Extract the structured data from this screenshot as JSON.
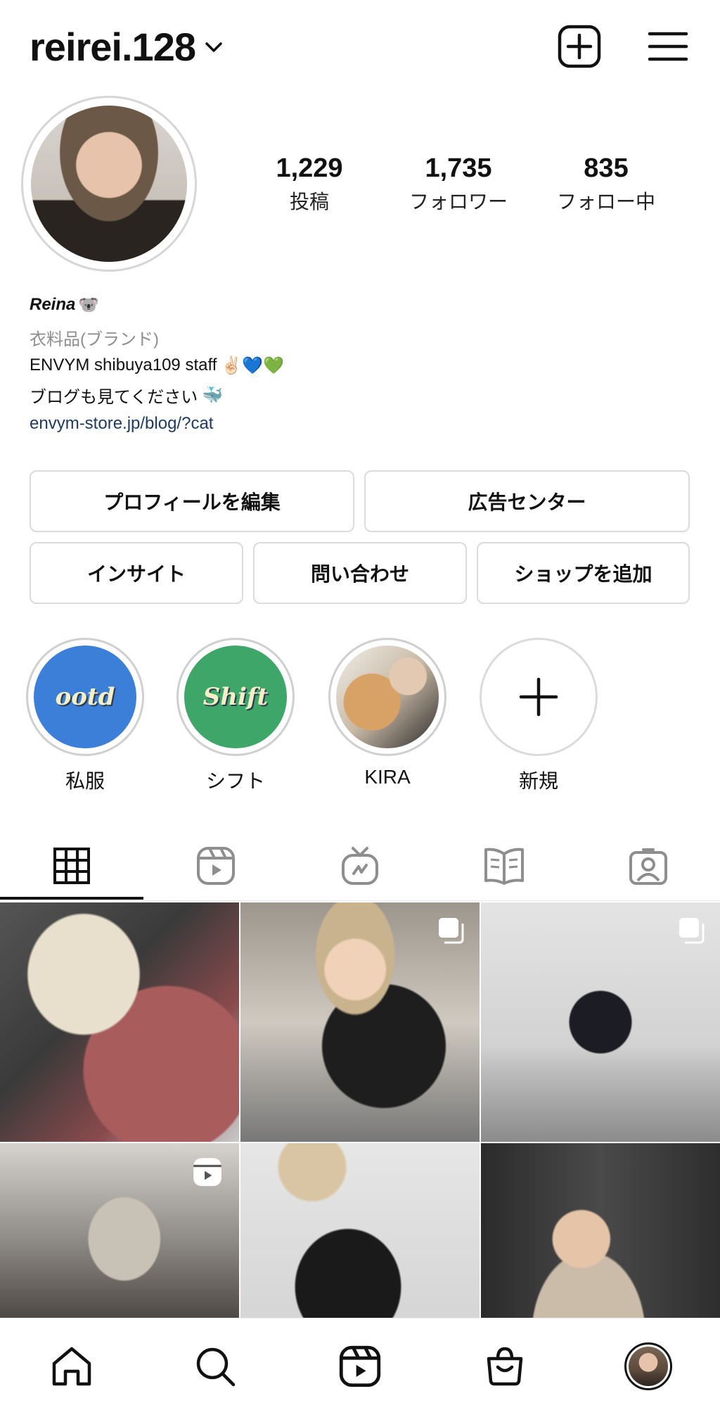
{
  "header": {
    "username": "reirei.128",
    "icons": [
      "chevron-down-icon",
      "plus-square-icon",
      "hamburger-menu-icon"
    ]
  },
  "stats": [
    {
      "value": "1,229",
      "label": "投稿"
    },
    {
      "value": "1,735",
      "label": "フォロワー"
    },
    {
      "value": "835",
      "label": "フォロー中"
    }
  ],
  "bio": {
    "name": "Reina",
    "name_emoji": "🐨",
    "category": "衣料品(ブランド)",
    "line1": "ENVYM shibuya109 staff",
    "line1_emoji": "✌🏻💙💚",
    "line2": "ブログも見てください",
    "line2_emoji": "🐳",
    "link": "envym-store.jp/blog/?cat"
  },
  "buttons": {
    "edit_profile": "プロフィールを編集",
    "ad_center": "広告センター",
    "insights": "インサイト",
    "contact": "問い合わせ",
    "add_shop": "ショップを追加"
  },
  "highlights": [
    {
      "label": "私服",
      "cover_text": "ootd",
      "color": "#3b7fd9"
    },
    {
      "label": "シフト",
      "cover_text": "Shift",
      "color": "#3fa66a"
    },
    {
      "label": "KIRA",
      "cover_text": "",
      "color": "#b8a48e"
    },
    {
      "label": "新規",
      "cover_text": "",
      "color": "#ffffff"
    }
  ],
  "tabs": [
    "grid-icon",
    "reels-icon",
    "igtv-icon",
    "guides-icon",
    "tagged-icon"
  ],
  "grid_posts": [
    {
      "overlay_icon": ""
    },
    {
      "overlay_icon": "carousel-icon"
    },
    {
      "overlay_icon": "carousel-icon"
    },
    {
      "overlay_icon": "reels-icon"
    },
    {
      "overlay_icon": ""
    },
    {
      "overlay_icon": ""
    }
  ],
  "bottom_nav": [
    "home-icon",
    "search-icon",
    "reels-icon",
    "shop-icon",
    "profile-avatar"
  ]
}
